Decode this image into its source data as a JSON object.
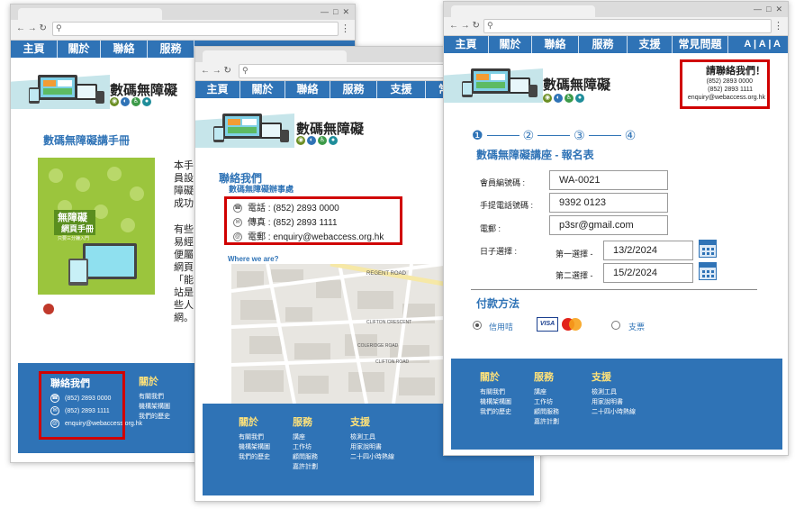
{
  "nav": {
    "home": "主頁",
    "about": "關於",
    "contact": "聯絡",
    "services": "服務",
    "support": "支援",
    "faq": "常見問題",
    "faq_cut": "常見問題",
    "support_cut": "支援",
    "faq_cut2": "常",
    "font_size": "A | A | A"
  },
  "site": {
    "name": "數碼無障礙"
  },
  "win1": {
    "heading": "數碼無障礙講手冊",
    "book": {
      "title": "無障礙",
      "subtitle": "網頁手冊",
      "line": "只要三分鐘入門"
    },
    "paragraph1": [
      "本手",
      "員設",
      "障礙",
      "成功"
    ],
    "paragraph2": [
      "有些",
      "易經",
      "便屬",
      "網頁",
      "「能",
      "站是",
      "些人",
      "網。"
    ],
    "footer": {
      "contact_title": "聯絡我們",
      "phone": "(852) 2893 0000",
      "fax": "(852) 2893 1111",
      "email": "enquiry@webaccess.org.hk",
      "about_title": "關於",
      "about_links": [
        "有關我們",
        "機構架構圖",
        "我們的歷史"
      ]
    }
  },
  "win2": {
    "contact_title": "聯絡我們",
    "office": "數碼無障礙辦事處",
    "phone": "電話 : (852) 2893 0000",
    "fax": "傳真 : (852) 2893 1111",
    "email": "電郵 : enquiry@webaccess.org.hk",
    "where": "Where we are?",
    "map_labels": [
      "REGENT ROAD",
      "CLIFTON CRESCENT",
      "CLIFTON ROAD",
      "COLERIDGE ROAD"
    ],
    "footer": {
      "about_title": "關於",
      "about_links": [
        "有關我們",
        "機構架構圖",
        "我們的歷史"
      ],
      "services_title": "服務",
      "services_links": [
        "講座",
        "工作坊",
        "顧問服務",
        "嘉許計劃"
      ],
      "support_title": "支援",
      "support_links": [
        "檢測工具",
        "用家說明書",
        "二十四小時熱線"
      ]
    }
  },
  "win3": {
    "contact_title": "請聯絡我們！",
    "phone": "(852) 2893 0000",
    "fax": "(852) 2893 1111",
    "email": "enquiry@webaccess.org.hk",
    "steps": [
      "❶",
      "②",
      "③",
      "④"
    ],
    "form_title": "數碼無障礙講座 - 報名表",
    "member_label": "會員編號碼 :",
    "member_value": "WA-0021",
    "mobile_label": "手提電話號碼 :",
    "mobile_value": "9392 0123",
    "email_label": "電郵 :",
    "email_value": "p3sr@gmail.com",
    "date_label": "日子選擇 :",
    "choice1_label": "第一選擇 -",
    "choice1_value": "13/2/2024",
    "choice2_label": "第二選擇 -",
    "choice2_value": "15/2/2024",
    "payment_title": "付款方法",
    "credit_card": "信用咭",
    "cheque": "支票",
    "card_visa": "VISA",
    "footer": {
      "about_title": "關於",
      "about_links": [
        "有關我們",
        "機構架構圖",
        "我們的歷史"
      ],
      "services_title": "服務",
      "services_links": [
        "講座",
        "工作坊",
        "顧問服務",
        "嘉許計劃"
      ],
      "support_title": "支援",
      "support_links": [
        "檢測工具",
        "用家說明書",
        "二十四小時熱線"
      ]
    }
  },
  "colors": {
    "nav_blue": "#2f73b6",
    "highlight_red": "#d00000",
    "footer_heading": "#ffe27a",
    "teal": "#1f8d9a"
  }
}
